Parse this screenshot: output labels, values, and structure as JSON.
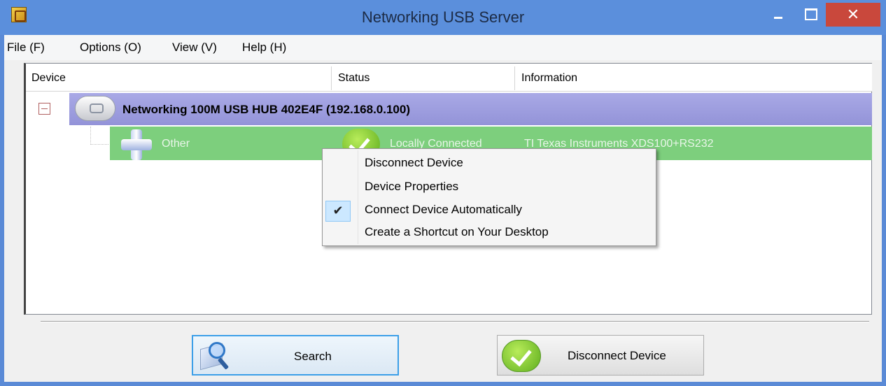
{
  "window": {
    "title": "Networking USB Server",
    "close_glyph": "✕"
  },
  "menu": {
    "items": [
      "File (F)",
      "Options (O)",
      "View (V)",
      "Help (H)"
    ]
  },
  "columns": [
    "Device",
    "Status",
    "Information"
  ],
  "hub": {
    "label": "Networking 100M USB HUB 402E4F  (192.168.0.100)",
    "expander": "collapse-minus",
    "icon": "usb-hub-icon"
  },
  "device": {
    "name": "Other",
    "status": "Locally Connected",
    "information": "TI Texas Instruments XDS100+RS232",
    "icon": "plus-device-icon",
    "status_icon": "green-check-icon"
  },
  "context_menu": {
    "items": [
      {
        "label": "Disconnect Device",
        "checked": false
      },
      {
        "label": "Device Properties",
        "checked": false
      },
      {
        "label": "Connect Device Automatically",
        "checked": true
      },
      {
        "label": "Create a Shortcut on Your Desktop",
        "checked": false
      }
    ],
    "check_glyph": "✔"
  },
  "buttons": {
    "search_label": "Search",
    "disconnect_label": "Disconnect Device"
  },
  "colors": {
    "title_bar": "#5b8fdc",
    "close_button": "#c9483c",
    "hub_row": "#9e9ede",
    "device_row": "#7dcf7d",
    "menu_check_highlight": "#cce8ff"
  }
}
